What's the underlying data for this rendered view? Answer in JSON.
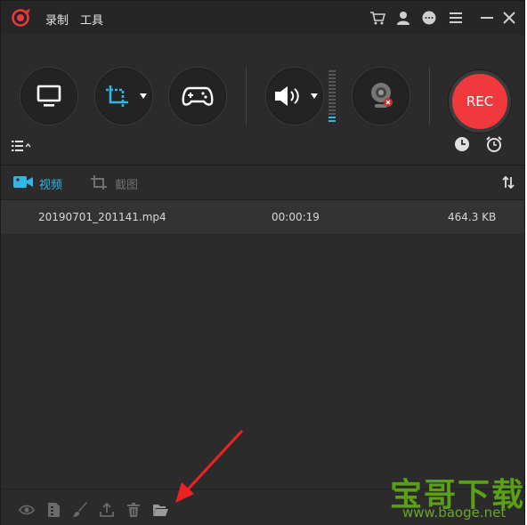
{
  "app": {
    "logo_icon": "record-logo-icon"
  },
  "menu": {
    "record": "录制",
    "tools": "工具"
  },
  "titlebar_icons": [
    "cart-icon",
    "user-icon",
    "chat-icon",
    "menu-icon",
    "minimize-icon",
    "close-icon"
  ],
  "toolbar": {
    "buttons": [
      "fullscreen-monitor-icon",
      "crop-region-icon",
      "gamepad-icon",
      "speaker-icon",
      "webcam-icon"
    ],
    "rec_label": "REC",
    "list_icon": "list-icon",
    "schedule_icon": "clock-icon",
    "alarm_icon": "alarm-icon"
  },
  "tabs": {
    "video_label": "视频",
    "screenshot_label": "截图",
    "active": "video",
    "accent_color": "#32b6e6",
    "sort_icon": "sort-icon"
  },
  "files": [
    {
      "name": "20190701_201141.mp4",
      "duration": "00:00:19",
      "size": "464.3 KB"
    }
  ],
  "bottom_icons": [
    "eye-icon",
    "file-info-icon",
    "brush-icon",
    "upload-icon",
    "trash-icon",
    "folder-open-icon"
  ],
  "watermark": {
    "title": "宝哥下载",
    "url": "www.baoge.net"
  },
  "colors": {
    "rec": "#f0393d",
    "background": "#2b2b2b",
    "arrow": "#ee2222"
  }
}
